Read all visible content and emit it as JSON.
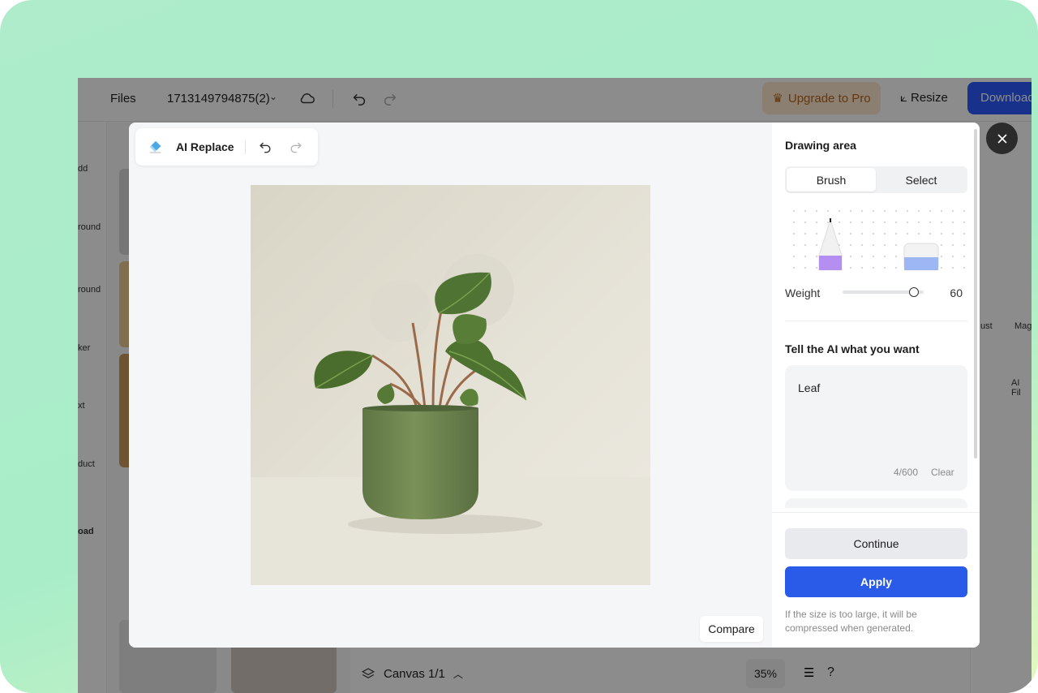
{
  "topbar": {
    "files_label": "Files",
    "file_name": "1713149794875(2)",
    "upgrade_label": "Upgrade to Pro",
    "resize_label": "Resize",
    "download_label": "Download"
  },
  "left_rail": {
    "items": [
      "dd",
      "round",
      "round",
      "ker",
      "xt",
      "duct",
      "oad"
    ]
  },
  "right_panel": {
    "items": [
      "ust",
      "Mag",
      "AI Fil"
    ]
  },
  "canvas_bar": {
    "canvas_label": "Canvas 1/1",
    "zoom": "35%",
    "help": "?"
  },
  "modal": {
    "tool_title": "AI Replace",
    "compare_label": "Compare",
    "drawing_area_heading": "Drawing area",
    "modes": [
      "Brush",
      "Select"
    ],
    "active_mode": "Brush",
    "weight_label": "Weight",
    "weight_value": "60",
    "weight_fraction": 0.93,
    "prompt_heading": "Tell the AI what you want",
    "prompt_value": "Leaf",
    "char_count": "4/600",
    "clear_label": "Clear",
    "continue_label": "Continue",
    "apply_label": "Apply",
    "note": "If the size is too large, it will be compressed when generated."
  },
  "colors": {
    "primary": "#2a5ae8",
    "upgrade_bg": "#fde7cf",
    "upgrade_text": "#b5651d",
    "pot_green": "#6f8752",
    "photo_bg": "#e3e0d5"
  }
}
